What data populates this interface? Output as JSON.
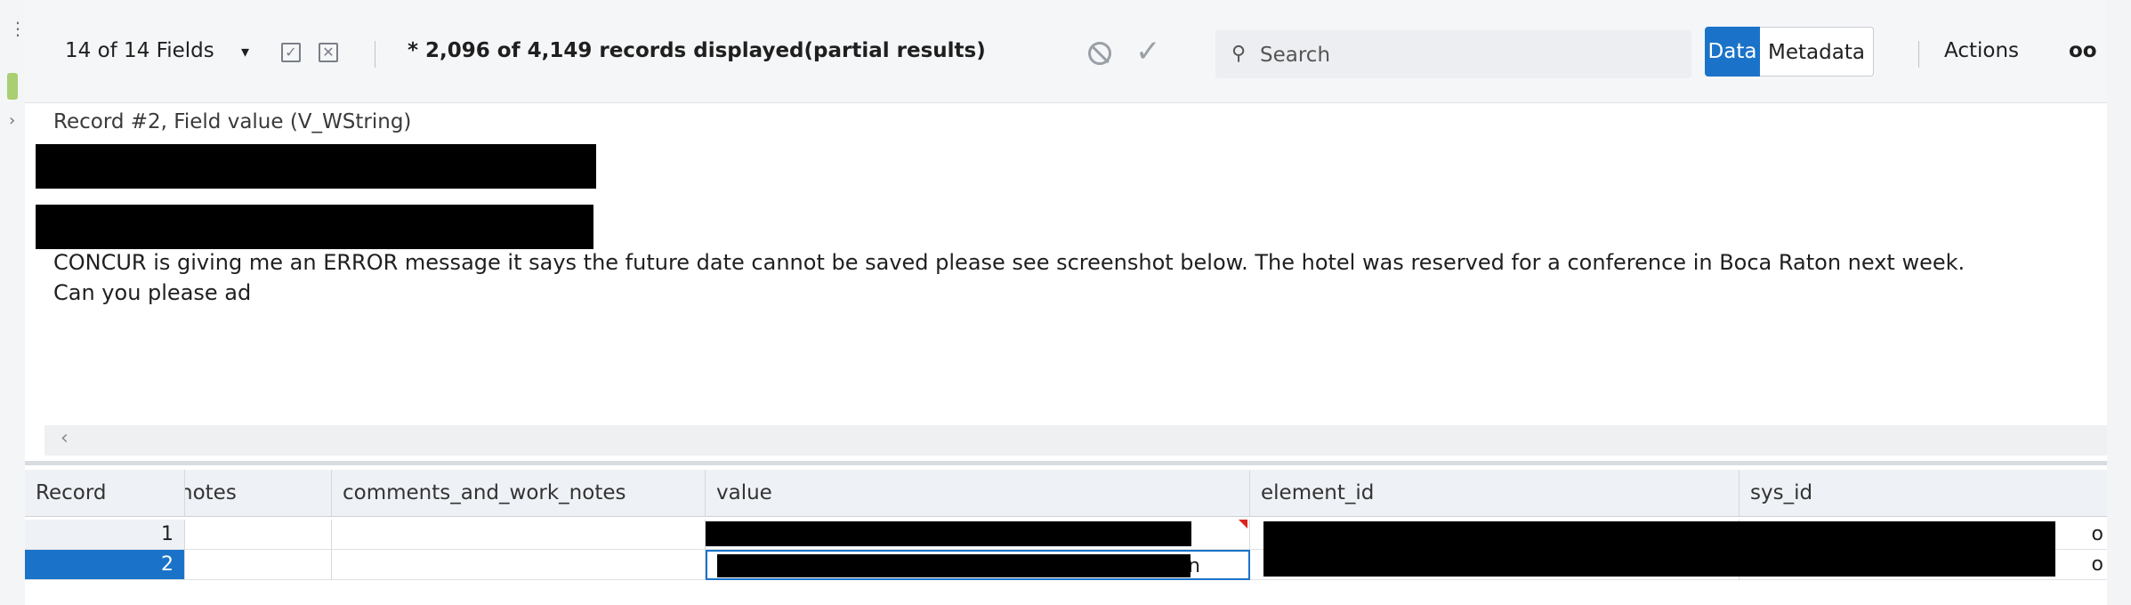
{
  "toolbar": {
    "fields_label": "14 of 14 Fields",
    "records_label": "* 2,096 of 4,149 records displayed(partial results)",
    "search_placeholder": "Search",
    "data_tab": "Data",
    "metadata_tab": "Metadata",
    "actions_label": "Actions",
    "overflow_label": "oo"
  },
  "viewer": {
    "caption": "Record #2, Field value (V_WString)",
    "message_line1": "CONCUR is giving me an ERROR message it says the future date cannot be saved please see screenshot below.  The hotel was reserved for a conference in Boca Raton next week.",
    "message_line2": "Can you please ad"
  },
  "grid": {
    "columns": [
      "Record",
      "notes",
      "comments_and_work_notes",
      "value",
      "element_id",
      "sys_id"
    ],
    "rows": [
      {
        "record": "1",
        "value_suffix": "",
        "sys_suffix": "o"
      },
      {
        "record": "2",
        "value_suffix": "n",
        "sys_suffix": "o"
      }
    ]
  },
  "colors": {
    "accent": "#1a73c8",
    "toolbar_bg": "#f5f6f8",
    "redaction": "#000000",
    "modified_marker": "#d9261c"
  },
  "icons": [
    "menu-icon",
    "search-icon",
    "cancel-icon",
    "check-icon",
    "dropdown-caret-icon",
    "select-all-icon",
    "deselect-icon",
    "scroll-left-icon"
  ]
}
